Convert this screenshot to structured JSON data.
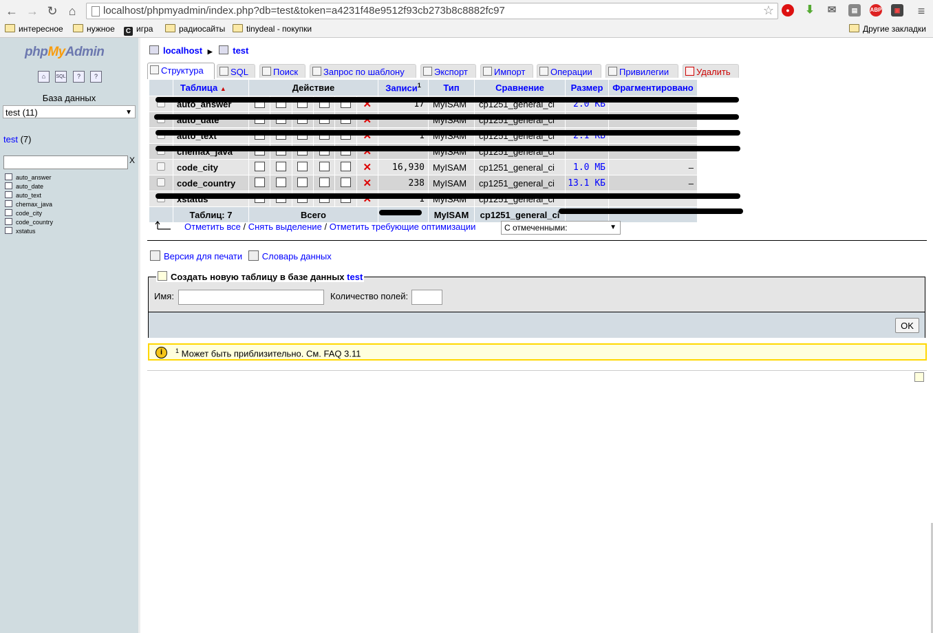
{
  "browser": {
    "url": "localhost/phpmyadmin/index.php?db=test&token=a4231f48e9512f93cb273b8c8882fc97",
    "extensions": [
      "stop-icon",
      "download-icon",
      "mail-icon",
      "extension-icon",
      "adblock-icon",
      "resolution-icon"
    ],
    "adblock_label": "ABP",
    "bookmarks": [
      "интересное",
      "нужное",
      "игра",
      "радиосайты",
      "tinydeal - покупки"
    ],
    "bookmark_c_glyph": "C",
    "other_bookmarks": "Другие закладки"
  },
  "sidebar": {
    "logo_php": "php",
    "logo_my": "My",
    "logo_admin": "Admin",
    "db_label": "База данных",
    "db_selected": "test (11)",
    "db_link": "test",
    "db_count": "(7)",
    "filter_clear": "X",
    "tables": [
      "auto_answer",
      "auto_date",
      "auto_text",
      "chemax_java",
      "code_city",
      "code_country",
      "xstatus"
    ]
  },
  "main": {
    "breadcrumb_server": "localhost",
    "breadcrumb_db": "test",
    "tabs": [
      "Структура",
      "SQL",
      "Поиск",
      "Запрос по шаблону",
      "Экспорт",
      "Импорт",
      "Операции",
      "Привилегии",
      "Удалить"
    ],
    "headers": {
      "table": "Таблица",
      "action": "Действие",
      "records": "Записи",
      "records_sup": "1",
      "type": "Тип",
      "collation": "Сравнение",
      "size": "Размер",
      "overhead": "Фрагментировано"
    },
    "rows": [
      {
        "name": "auto_answer",
        "records": "17",
        "type": "MyISAM",
        "collation": "cp1251_general_ci",
        "size": "2.0 КБ",
        "overhead": ""
      },
      {
        "name": "auto_date",
        "records": "",
        "type": "MyISAM",
        "collation": "cp1251_general_ci",
        "size": "",
        "overhead": ""
      },
      {
        "name": "auto_text",
        "records": "1",
        "type": "MyISAM",
        "collation": "cp1251_general_ci",
        "size": "2.1 КБ",
        "overhead": ""
      },
      {
        "name": "chemax_java",
        "records": "",
        "type": "MyISAM",
        "collation": "cp1251_general_ci",
        "size": "",
        "overhead": ""
      },
      {
        "name": "code_city",
        "records": "16,930",
        "type": "MyISAM",
        "collation": "cp1251_general_ci",
        "size": "1.0 МБ",
        "overhead": "–"
      },
      {
        "name": "code_country",
        "records": "238",
        "type": "MyISAM",
        "collation": "cp1251_general_ci",
        "size": "13.1 КБ",
        "overhead": "–"
      },
      {
        "name": "xstatus",
        "records": "1",
        "type": "MyISAM",
        "collation": "cp1251_general_ci",
        "size": "",
        "overhead": ""
      }
    ],
    "footer": {
      "tables": "Таблиц: 7",
      "total": "Всего",
      "type": "MyISAM",
      "collation": "cp1251_general_ci"
    },
    "check_all": "Отметить все",
    "uncheck_all": "Снять выделение",
    "check_overhead": "Отметить требующие оптимизации",
    "sep": "/",
    "with_selected": "С отмеченными:",
    "print_view": "Версия для печати",
    "data_dict": "Словарь данных",
    "create_title": "Создать новую таблицу в базе данных",
    "create_db": "test",
    "name_label": "Имя:",
    "fields_label": "Количество полей:",
    "ok": "OK",
    "notice_sup": "1",
    "notice_text": "Может быть приблизительно. См. FAQ 3.11"
  }
}
